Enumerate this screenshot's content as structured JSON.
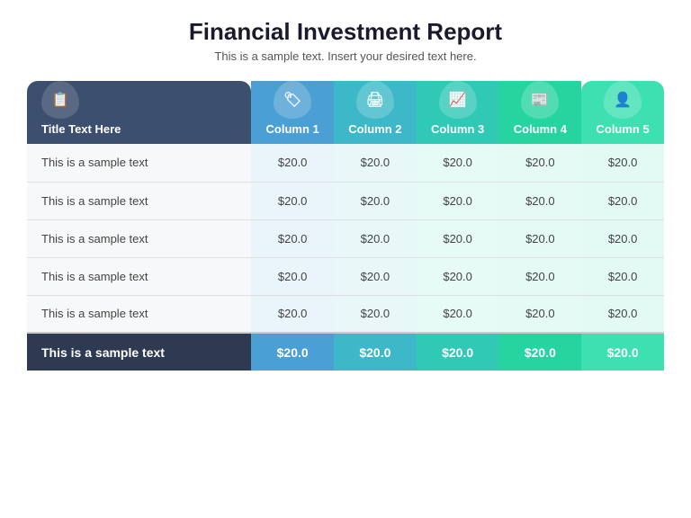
{
  "header": {
    "title": "Financial Investment Report",
    "subtitle": "This is a sample text. Insert your desired text here."
  },
  "table": {
    "columns": [
      {
        "id": "title",
        "label": "Title Text Here",
        "icon": "📋"
      },
      {
        "id": "col1",
        "label": "Column 1",
        "icon": "🏷️"
      },
      {
        "id": "col2",
        "label": "Column 2",
        "icon": "🖨️"
      },
      {
        "id": "col3",
        "label": "Column 3",
        "icon": "📊"
      },
      {
        "id": "col4",
        "label": "Column 4",
        "icon": "📰"
      },
      {
        "id": "col5",
        "label": "Column 5",
        "icon": "👤"
      }
    ],
    "rows": [
      {
        "label": "This is a sample text",
        "col1": "$20.0",
        "col2": "$20.0",
        "col3": "$20.0",
        "col4": "$20.0",
        "col5": "$20.0"
      },
      {
        "label": "This is a sample text",
        "col1": "$20.0",
        "col2": "$20.0",
        "col3": "$20.0",
        "col4": "$20.0",
        "col5": "$20.0"
      },
      {
        "label": "This is a sample text",
        "col1": "$20.0",
        "col2": "$20.0",
        "col3": "$20.0",
        "col4": "$20.0",
        "col5": "$20.0"
      },
      {
        "label": "This is a sample text",
        "col1": "$20.0",
        "col2": "$20.0",
        "col3": "$20.0",
        "col4": "$20.0",
        "col5": "$20.0"
      },
      {
        "label": "This is a sample text",
        "col1": "$20.0",
        "col2": "$20.0",
        "col3": "$20.0",
        "col4": "$20.0",
        "col5": "$20.0"
      }
    ],
    "total_row": {
      "label": "This is a sample text",
      "col1": "$20.0",
      "col2": "$20.0",
      "col3": "$20.0",
      "col4": "$20.0",
      "col5": "$20.0"
    }
  }
}
